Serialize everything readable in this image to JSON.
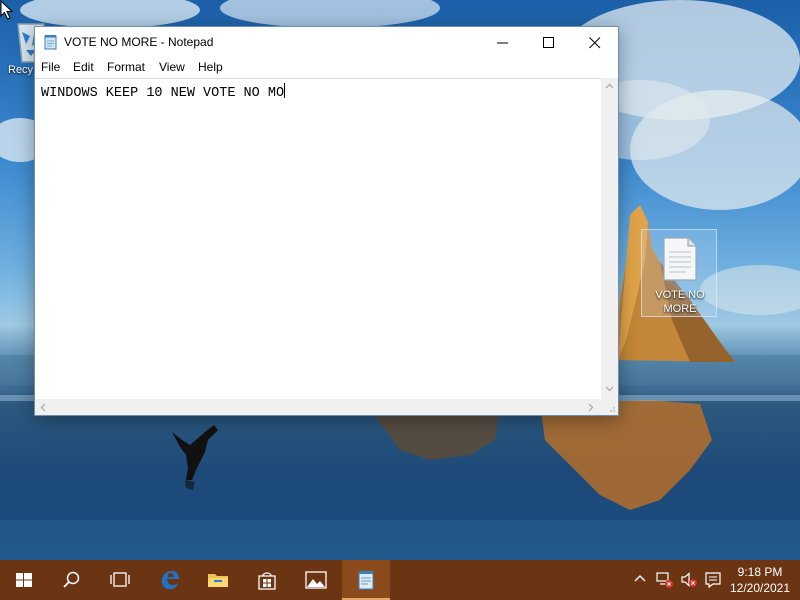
{
  "desktop": {
    "recycle_bin_label": "Recy",
    "file_icon_label_line1": "VOTE NO",
    "file_icon_label_line2": "MORE"
  },
  "window": {
    "title": "VOTE NO MORE - Notepad",
    "menu": [
      "File",
      "Edit",
      "Format",
      "View",
      "Help"
    ],
    "content": "WINDOWS KEEP 10 NEW VOTE NO MO"
  },
  "taskbar": {
    "buttons": [
      "start-icon",
      "search-icon",
      "task-view-icon",
      "edge-icon",
      "file-explorer-icon",
      "store-icon",
      "photos-icon",
      "notepad-icon"
    ],
    "time": "9:18 PM",
    "date": "12/20/2021"
  },
  "colors": {
    "taskbar_bg": "#6b3513",
    "taskbar_active": "#8c4a1c",
    "accent": "#1e73c8"
  }
}
